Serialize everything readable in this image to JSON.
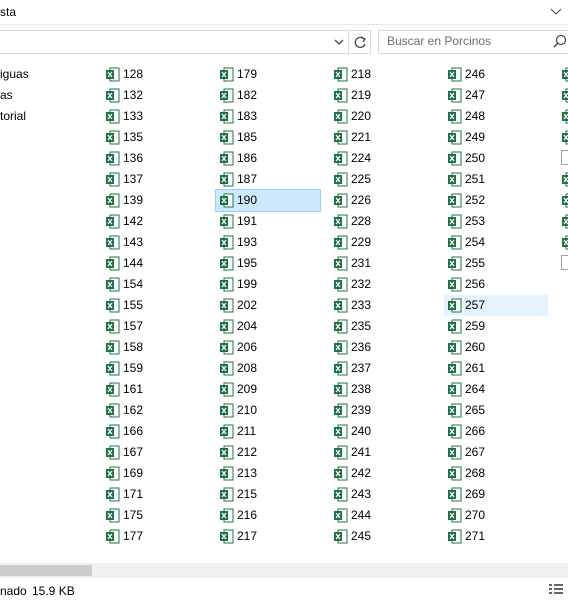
{
  "window": {
    "title_partial": "sta"
  },
  "address": {
    "value": ""
  },
  "search": {
    "placeholder": "Buscar en Porcinos"
  },
  "nav": {
    "items": [
      "iguas",
      "as",
      "torial"
    ]
  },
  "columns": [
    [
      "128",
      "132",
      "133",
      "135",
      "136",
      "137",
      "139",
      "142",
      "143",
      "144",
      "154",
      "155",
      "157",
      "158",
      "159",
      "161",
      "162",
      "166",
      "167",
      "169",
      "171",
      "175",
      "177"
    ],
    [
      "179",
      "182",
      "183",
      "185",
      "186",
      "187",
      "190",
      "191",
      "193",
      "195",
      "199",
      "202",
      "204",
      "206",
      "208",
      "209",
      "210",
      "211",
      "212",
      "213",
      "215",
      "216",
      "217"
    ],
    [
      "218",
      "219",
      "220",
      "221",
      "224",
      "225",
      "226",
      "228",
      "229",
      "231",
      "232",
      "233",
      "235",
      "236",
      "237",
      "238",
      "239",
      "240",
      "241",
      "242",
      "243",
      "244",
      "245"
    ],
    [
      "246",
      "247",
      "248",
      "249",
      "250",
      "251",
      "252",
      "253",
      "254",
      "255",
      "256",
      "257",
      "259",
      "260",
      "261",
      "264",
      "265",
      "266",
      "267",
      "268",
      "269",
      "270",
      "271"
    ]
  ],
  "selected_file": "190",
  "hovered_file": "257",
  "status": {
    "partial_label": "nado",
    "size": "15.9 KB"
  },
  "colors": {
    "selection": "#cce8ff",
    "hover": "#e5f3ff",
    "excel_green": "#1d7044"
  },
  "icons": {
    "file": "excel-file-icon",
    "search": "search-icon",
    "refresh": "refresh-icon"
  }
}
